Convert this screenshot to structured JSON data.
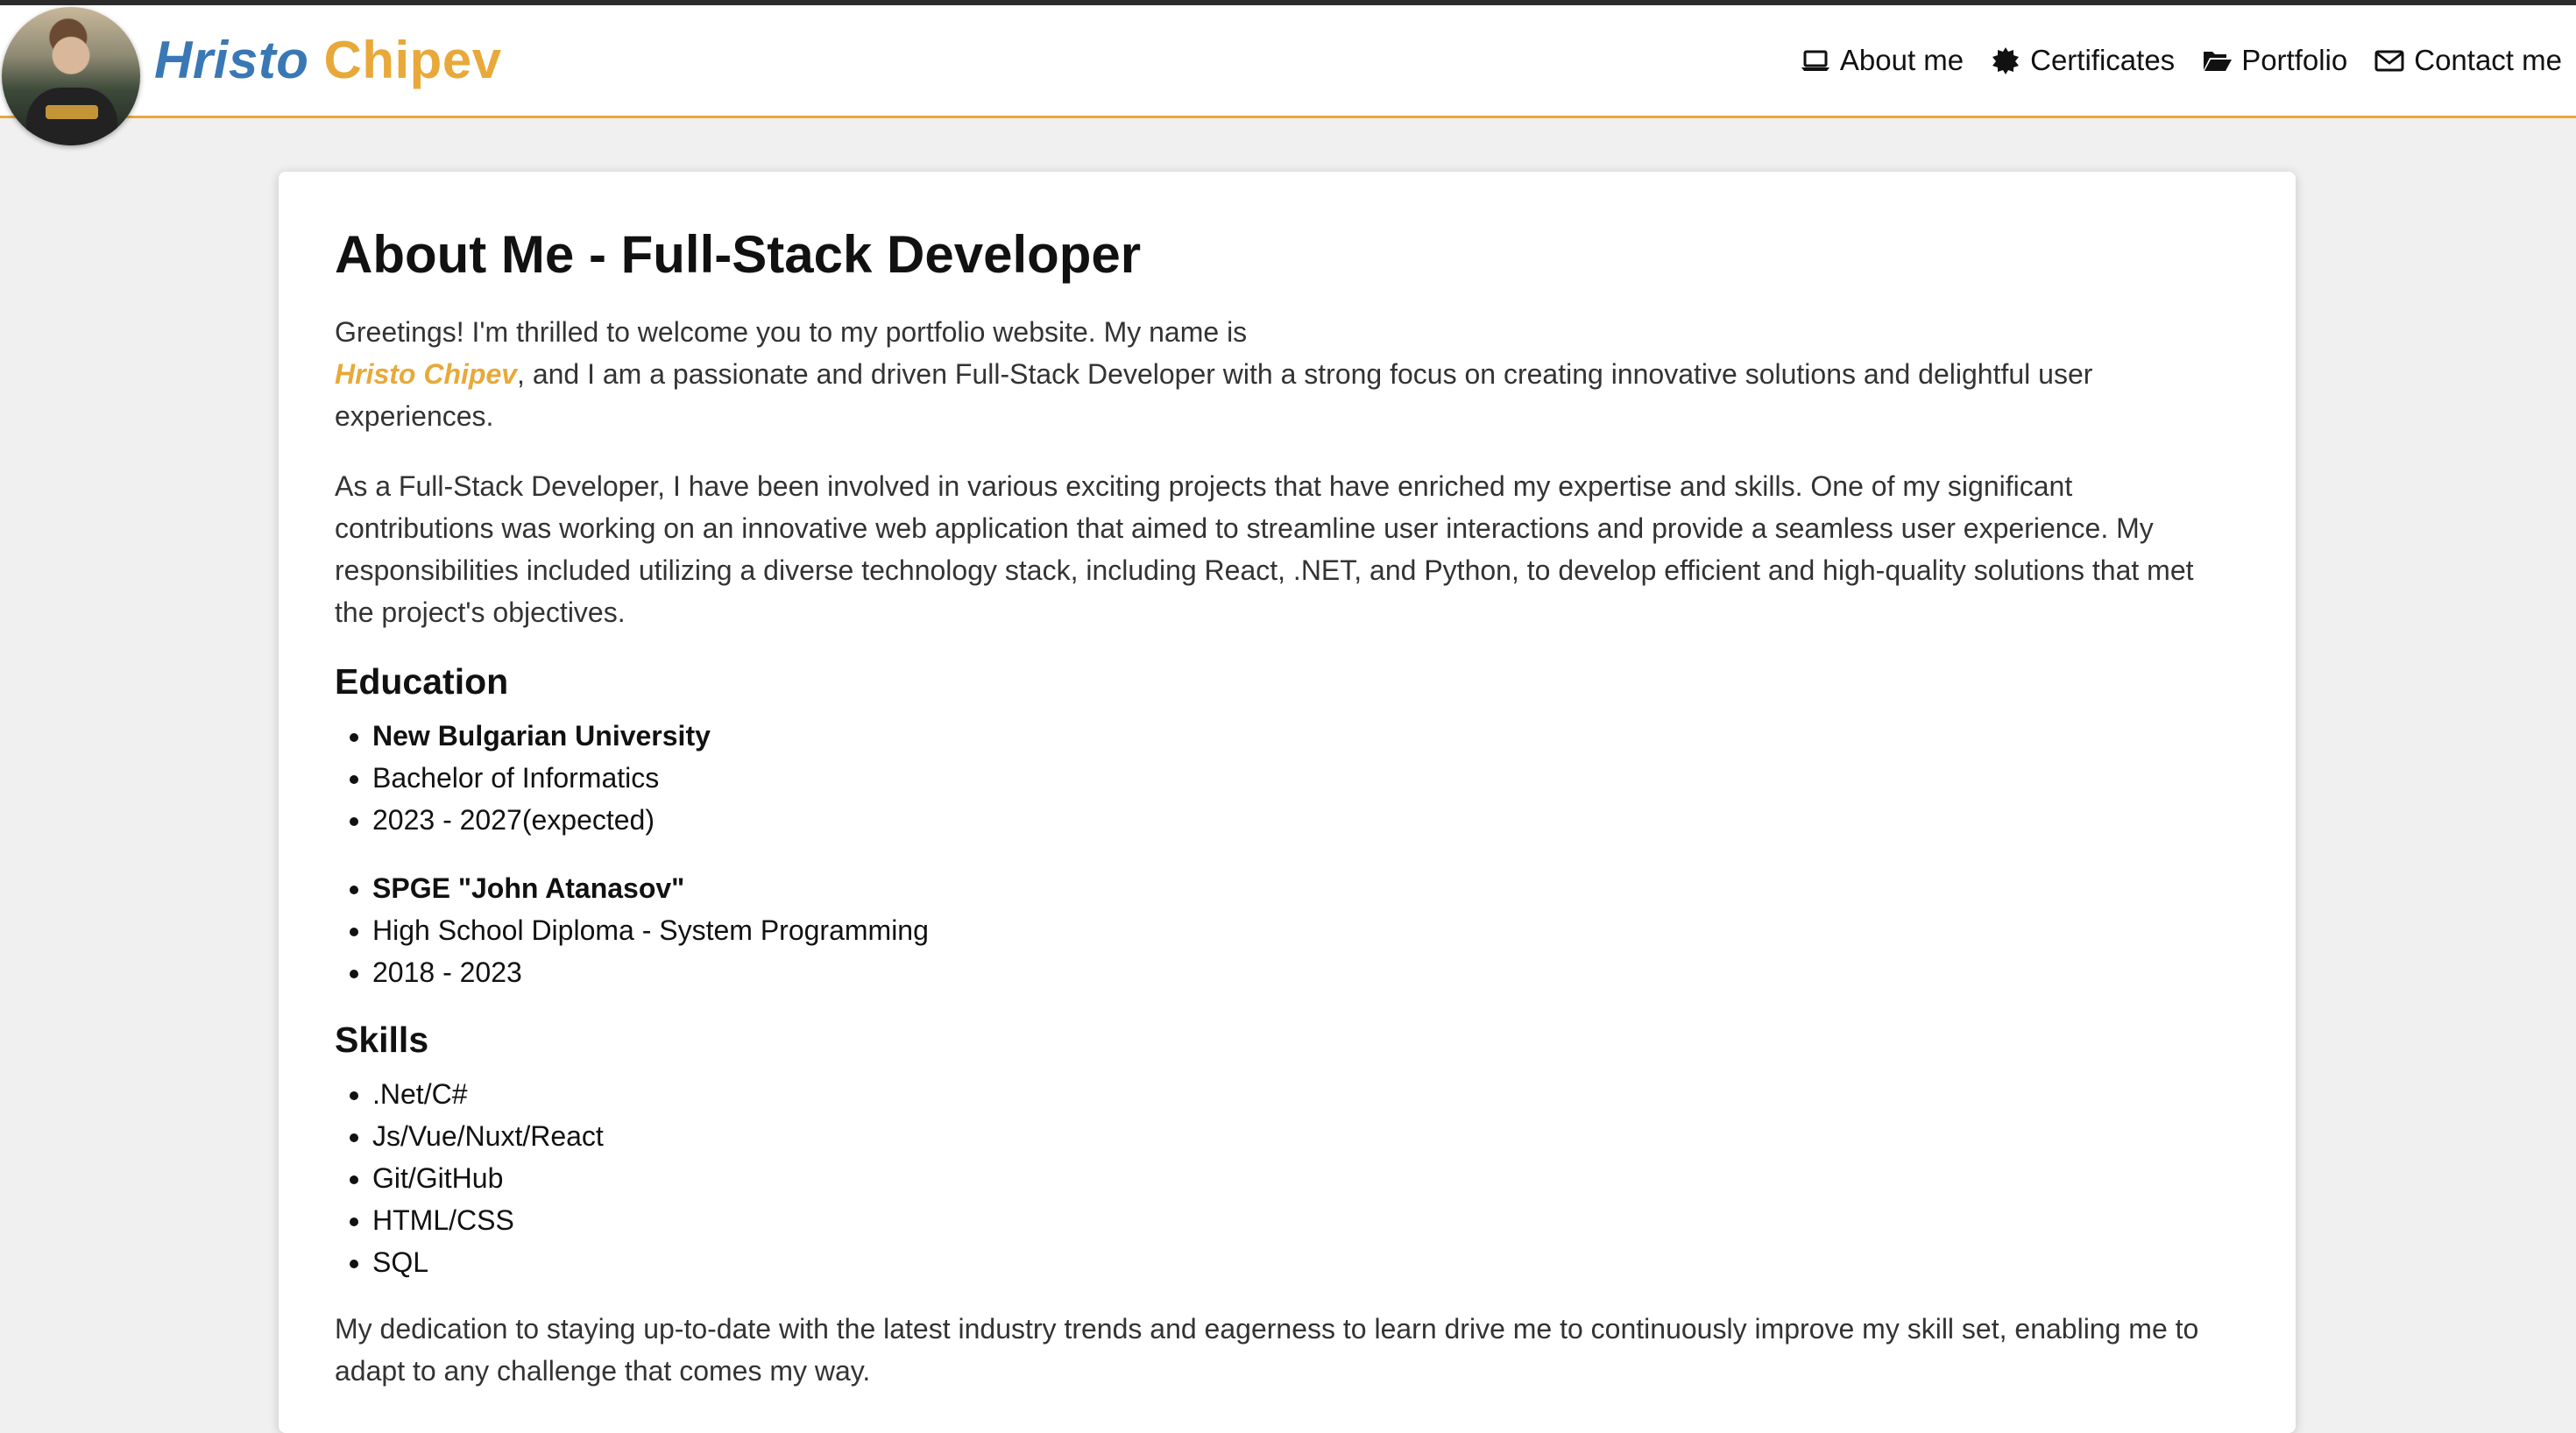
{
  "header": {
    "brand_first": "Hristo",
    "brand_last": "Chipev",
    "nav": [
      {
        "label": "About me",
        "icon": "laptop-icon"
      },
      {
        "label": "Certificates",
        "icon": "certificate-icon"
      },
      {
        "label": "Portfolio",
        "icon": "folder-open-icon"
      },
      {
        "label": "Contact me",
        "icon": "envelope-icon"
      }
    ]
  },
  "colors": {
    "accent_orange": "#e8a93a",
    "brand_blue": "#3a78b5",
    "page_bg": "#f0f0f0"
  },
  "main": {
    "title": "About Me - Full-Stack Developer",
    "intro_before": "Greetings! I'm thrilled to welcome you to my portfolio website. My name is",
    "intro_name": "Hristo Chipev",
    "intro_after": ", and I am a passionate and driven Full-Stack Developer with a strong focus on creating innovative solutions and delightful user experiences.",
    "paragraph2": "As a Full-Stack Developer, I have been involved in various exciting projects that have enriched my expertise and skills. One of my significant contributions was working on an innovative web application that aimed to streamline user interactions and provide a seamless user experience. My responsibilities included utilizing a diverse technology stack, including React, .NET, and Python, to develop efficient and high-quality solutions that met the project's objectives.",
    "education_heading": "Education",
    "education": [
      {
        "school": "New Bulgarian University",
        "degree": "Bachelor of Informatics",
        "years": "2023 - 2027(expected)"
      },
      {
        "school": "SPGE \"John Atanasov\"",
        "degree": "High School Diploma - System Programming",
        "years": "2018 - 2023"
      }
    ],
    "skills_heading": "Skills",
    "skills": [
      ".Net/C#",
      "Js/Vue/Nuxt/React",
      "Git/GitHub",
      "HTML/CSS",
      "SQL"
    ],
    "closing": "My dedication to staying up-to-date with the latest industry trends and eagerness to learn drive me to continuously improve my skill set, enabling me to adapt to any challenge that comes my way."
  }
}
